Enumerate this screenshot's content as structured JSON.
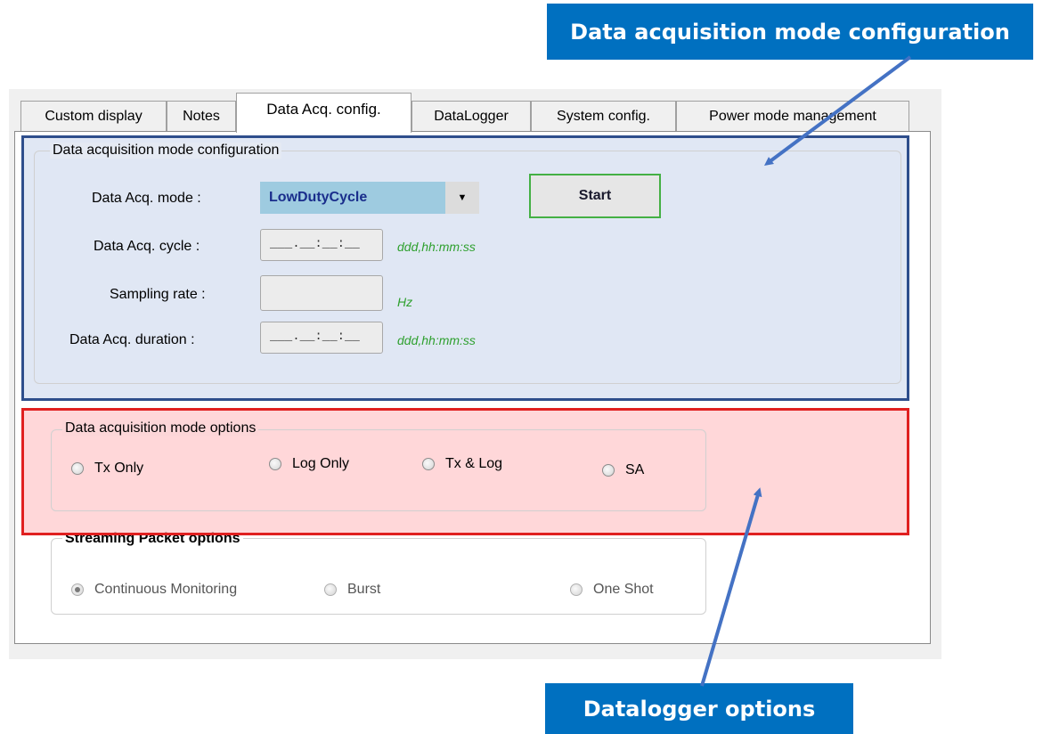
{
  "callouts": {
    "top": "Data acquisition  mode configuration",
    "bottom": "Datalogger options"
  },
  "tabs": [
    {
      "label": "Custom display"
    },
    {
      "label": "Notes"
    },
    {
      "label": "Data Acq. config."
    },
    {
      "label": "DataLogger"
    },
    {
      "label": "System config."
    },
    {
      "label": "Power mode management"
    }
  ],
  "active_tab": "Data Acq. config.",
  "config_group": {
    "title": "Data acquisition mode configuration",
    "mode_label": "Data Acq. mode :",
    "mode_value": "LowDutyCycle",
    "cycle_label": "Data Acq. cycle :",
    "cycle_mask": "___.__:__:__",
    "cycle_hint": "ddd,hh:mm:ss",
    "rate_label": "Sampling rate :",
    "rate_value": "",
    "rate_hint": "Hz",
    "duration_label": "Data Acq. duration :",
    "duration_mask": "___.__:__:__",
    "duration_hint": "ddd,hh:mm:ss",
    "start_label": "Start"
  },
  "options_group": {
    "title": "Data acquisition mode options",
    "items": [
      {
        "label": "Tx Only",
        "checked": false
      },
      {
        "label": "Log Only",
        "checked": false
      },
      {
        "label": "Tx & Log",
        "checked": false
      },
      {
        "label": "SA",
        "checked": false
      }
    ]
  },
  "streaming_group": {
    "title": "Streaming Packet options",
    "items": [
      {
        "label": "Continuous Monitoring",
        "checked": true
      },
      {
        "label": "Burst",
        "checked": false
      },
      {
        "label": "One Shot",
        "checked": false
      }
    ]
  },
  "colors": {
    "callout_bg": "#0070c0",
    "highlight_blue_border": "#2e4e8c",
    "highlight_red_border": "#e02020",
    "hint_text": "#2ea02e",
    "start_border": "#44b044",
    "mode_bg": "#9ecbe0",
    "arrow": "#4472c4"
  }
}
